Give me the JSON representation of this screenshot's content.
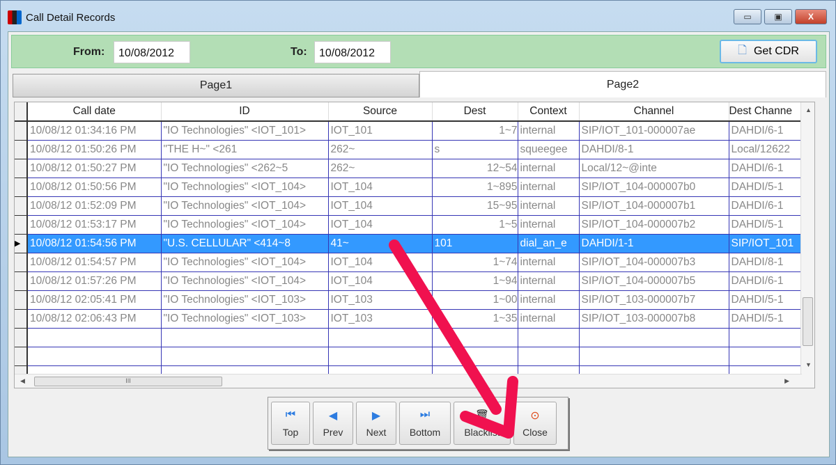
{
  "window": {
    "title": "Call Detail Records",
    "minimize": "▭",
    "maximize": "▣",
    "close": "X"
  },
  "filter": {
    "from_label": "From:",
    "from_value": "10/08/2012",
    "to_label": "To:",
    "to_value": "10/08/2012",
    "get_cdr": "Get CDR"
  },
  "tabs": [
    "Page1",
    "Page2"
  ],
  "grid": {
    "columns": [
      "Call date",
      "ID",
      "Source",
      "Dest",
      "Context",
      "Channel",
      "Dest Channe"
    ],
    "selected_row": 6,
    "rows": [
      [
        "10/08/12 01:34:16 PM",
        "\"IO Technologies\" <IOT_101>",
        "IOT_101",
        "1~7",
        "internal",
        "SIP/IOT_101-000007ae",
        "DAHDI/6-1"
      ],
      [
        "10/08/12 01:50:26 PM",
        "\"THE H~\" <261",
        "262~",
        "s",
        "squeegee",
        "DAHDI/8-1",
        "Local/12622"
      ],
      [
        "10/08/12 01:50:27 PM",
        "\"IO Technologies\" <262~5",
        "262~",
        "12~54",
        "internal",
        "Local/12~@inte",
        "DAHDI/6-1"
      ],
      [
        "10/08/12 01:50:56 PM",
        "\"IO Technologies\" <IOT_104>",
        "IOT_104",
        "1~895",
        "internal",
        "SIP/IOT_104-000007b0",
        "DAHDI/5-1"
      ],
      [
        "10/08/12 01:52:09 PM",
        "\"IO Technologies\" <IOT_104>",
        "IOT_104",
        "15~95",
        "internal",
        "SIP/IOT_104-000007b1",
        "DAHDI/6-1"
      ],
      [
        "10/08/12 01:53:17 PM",
        "\"IO Technologies\" <IOT_104>",
        "IOT_104",
        "1~5",
        "internal",
        "SIP/IOT_104-000007b2",
        "DAHDI/5-1"
      ],
      [
        "10/08/12 01:54:56 PM",
        "\"U.S. CELLULAR\" <414~8",
        "41~",
        "101",
        "dial_an_e",
        "DAHDI/1-1",
        "SIP/IOT_101"
      ],
      [
        "10/08/12 01:54:57 PM",
        "\"IO Technologies\" <IOT_104>",
        "IOT_104",
        "1~74",
        "internal",
        "SIP/IOT_104-000007b3",
        "DAHDI/8-1"
      ],
      [
        "10/08/12 01:57:26 PM",
        "\"IO Technologies\" <IOT_104>",
        "IOT_104",
        "1~94",
        "internal",
        "SIP/IOT_104-000007b5",
        "DAHDI/6-1"
      ],
      [
        "10/08/12 02:05:41 PM",
        "\"IO Technologies\" <IOT_103>",
        "IOT_103",
        "1~00",
        "internal",
        "SIP/IOT_103-000007b7",
        "DAHDI/5-1"
      ],
      [
        "10/08/12 02:06:43 PM",
        "\"IO Technologies\" <IOT_103>",
        "IOT_103",
        "1~35",
        "internal",
        "SIP/IOT_103-000007b8",
        "DAHDI/5-1"
      ]
    ],
    "empty_rows": 3,
    "hscroll_grip": "III"
  },
  "nav": [
    {
      "icon": "⏮",
      "label": "Top",
      "name": "top"
    },
    {
      "icon": "◀",
      "label": "Prev",
      "name": "prev"
    },
    {
      "icon": "▶",
      "label": "Next",
      "name": "next"
    },
    {
      "icon": "⏭",
      "label": "Bottom",
      "name": "bottom"
    },
    {
      "icon": "🗑",
      "label": "Blacklist",
      "name": "blacklist"
    },
    {
      "icon": "⊙",
      "label": "Close",
      "name": "close"
    }
  ],
  "colors": {
    "selection": "#3399ff",
    "grid_line": "#3535b5",
    "filter_bg": "#b3deb5",
    "annotation": "#f0114f"
  }
}
